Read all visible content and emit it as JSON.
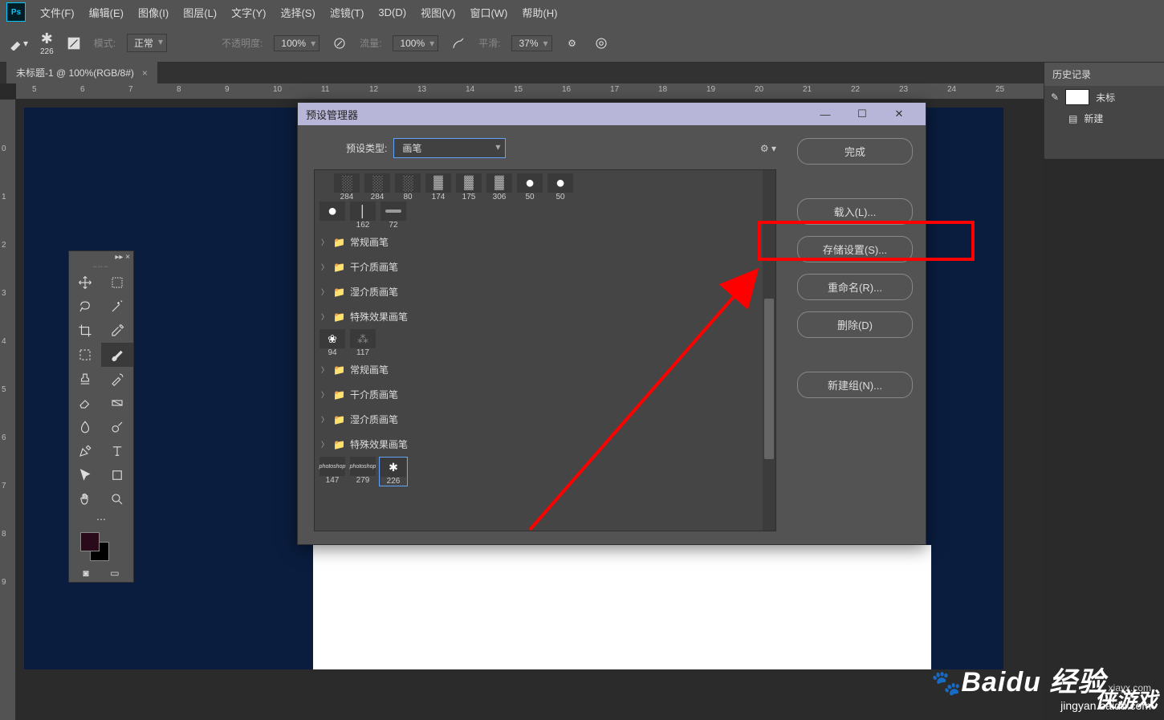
{
  "menubar": {
    "items": [
      "文件(F)",
      "编辑(E)",
      "图像(I)",
      "图层(L)",
      "文字(Y)",
      "选择(S)",
      "滤镜(T)",
      "3D(D)",
      "视图(V)",
      "窗口(W)",
      "帮助(H)"
    ]
  },
  "optbar": {
    "brush_size": "226",
    "mode_label": "模式:",
    "mode_value": "正常",
    "opacity_label": "不透明度:",
    "opacity_value": "100%",
    "flow_label": "流量:",
    "flow_value": "100%",
    "smooth_label": "平滑:",
    "smooth_value": "37%"
  },
  "doctab": {
    "title": "未标题-1 @ 100%(RGB/8#)",
    "close": "×"
  },
  "ruler_top": [
    "5",
    "6",
    "7",
    "8",
    "9",
    "10",
    "11",
    "12",
    "13",
    "14",
    "15",
    "16",
    "17",
    "18",
    "19",
    "20",
    "21",
    "22",
    "23",
    "24",
    "25"
  ],
  "ruler_left": [
    "0",
    "1",
    "2",
    "3",
    "4",
    "5",
    "6",
    "7",
    "8",
    "9"
  ],
  "rightpanel": {
    "title": "历史记录",
    "row1": "未标",
    "row2": "新建"
  },
  "toolbox": {
    "close": "×",
    "tools": [
      "move",
      "artboard",
      "lasso",
      "wand",
      "crop",
      "eyedrop",
      "marquee",
      "brush",
      "stamp",
      "history",
      "eraser",
      "gradient",
      "blur",
      "dodge",
      "pen",
      "type",
      "arrow",
      "shape",
      "hand",
      "zoom",
      "more"
    ]
  },
  "dialog": {
    "title": "预设管理器",
    "preset_type_label": "预设类型:",
    "preset_type_value": "画笔",
    "win_min": "—",
    "win_max": "☐",
    "win_close": "✕",
    "brush_row1": [
      {
        "sz": "284",
        "cls": "spray"
      },
      {
        "sz": "284",
        "cls": "spray"
      },
      {
        "sz": "80",
        "cls": "spray"
      },
      {
        "sz": "174",
        "cls": "tex"
      },
      {
        "sz": "175",
        "cls": "tex"
      },
      {
        "sz": "306",
        "cls": "tex"
      },
      {
        "sz": "50",
        "cls": "round"
      },
      {
        "sz": "50",
        "cls": "round"
      }
    ],
    "brush_row2": [
      {
        "sz": "",
        "cls": "round"
      },
      {
        "sz": "162",
        "cls": "thin"
      },
      {
        "sz": "72",
        "cls": "oval"
      }
    ],
    "folders": [
      "常规画笔",
      "干介质画笔",
      "湿介质画笔",
      "特殊效果画笔"
    ],
    "brush_row3": [
      {
        "sz": "94",
        "cls": "leaf"
      },
      {
        "sz": "117",
        "cls": "paw"
      }
    ],
    "folders2": [
      "常规画笔",
      "干介质画笔",
      "湿介质画笔",
      "特殊效果画笔"
    ],
    "brush_row4": [
      {
        "sz": "147",
        "lbl": "photoshop"
      },
      {
        "sz": "279",
        "lbl": "photoshop"
      },
      {
        "sz": "226",
        "cls": "star",
        "sel": true
      }
    ],
    "buttons": {
      "done": "完成",
      "load": "载入(L)...",
      "save": "存储设置(S)...",
      "rename": "重命名(R)...",
      "delete": "删除(D)",
      "newgroup": "新建组(N)..."
    }
  },
  "watermark": {
    "line1": "Baidu 经验",
    "line2": "jingyan.baidu.com",
    "url": "xiayx.com",
    "game": "侠游戏"
  }
}
